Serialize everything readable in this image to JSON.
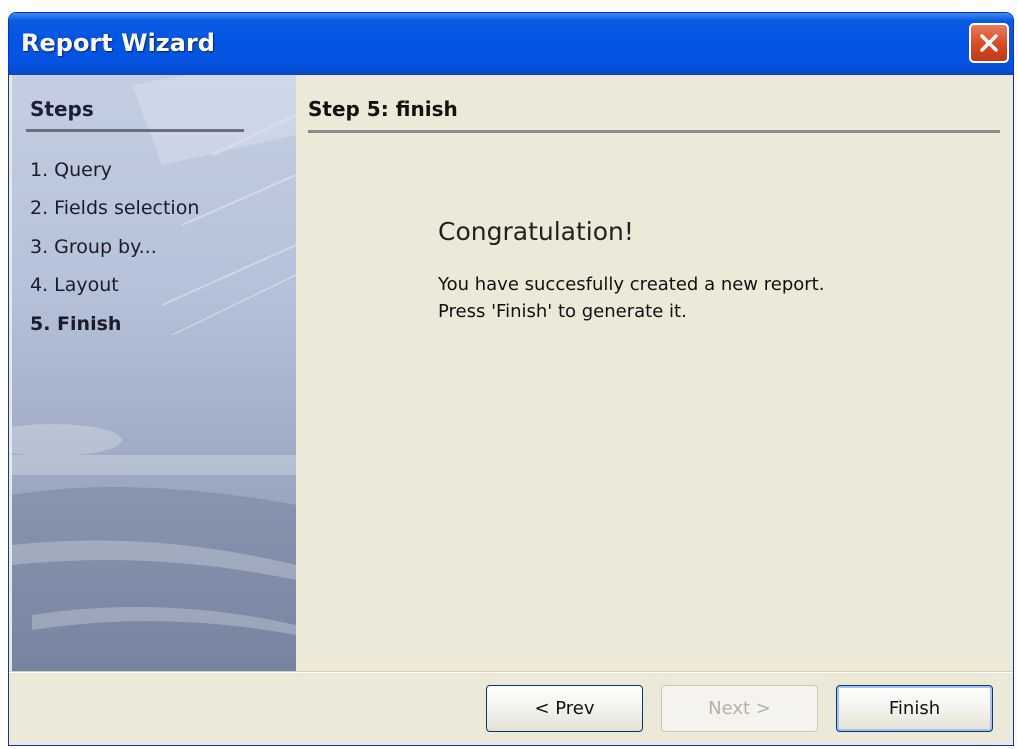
{
  "window": {
    "title": "Report Wizard"
  },
  "sidebar": {
    "heading": "Steps",
    "steps": [
      {
        "label": "1. Query",
        "active": false
      },
      {
        "label": "2. Fields selection",
        "active": false
      },
      {
        "label": "3. Group by...",
        "active": false
      },
      {
        "label": "4. Layout",
        "active": false
      },
      {
        "label": "5. Finish",
        "active": true
      }
    ]
  },
  "content": {
    "heading": "Step 5: finish",
    "congrats": "Congratulation!",
    "message_lines": [
      "You have succesfully created a new report.",
      "Press 'Finish' to generate it."
    ]
  },
  "buttons": {
    "prev": "< Prev",
    "next": "Next >",
    "finish": "Finish"
  },
  "colors": {
    "titlebar": "#0055e5",
    "close_button": "#d7491f",
    "dialog_background": "#ece9d8",
    "sidebar": "#b6c2d9"
  },
  "icons": {
    "close": "close-icon"
  }
}
